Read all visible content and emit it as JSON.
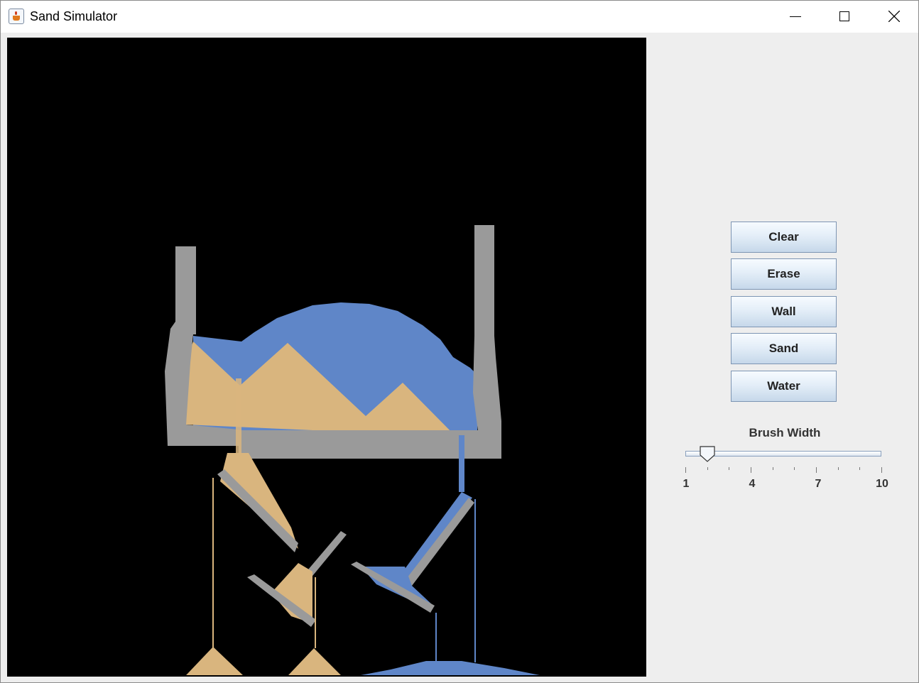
{
  "window": {
    "title": "Sand Simulator",
    "controls": {
      "minimize": "minimize-icon",
      "maximize": "maximize-icon",
      "close": "close-icon"
    }
  },
  "toolbar": {
    "buttons": [
      {
        "label": "Clear"
      },
      {
        "label": "Erase"
      },
      {
        "label": "Wall"
      },
      {
        "label": "Sand"
      },
      {
        "label": "Water"
      }
    ]
  },
  "brush": {
    "label": "Brush Width",
    "min": 1,
    "max": 10,
    "value": 2,
    "tick_labels": [
      "1",
      "4",
      "7",
      "10"
    ]
  },
  "colors": {
    "canvas_bg": "#000000",
    "wall": "#9a9a9a",
    "sand": "#d9b57e",
    "water": "#5f86c8"
  }
}
